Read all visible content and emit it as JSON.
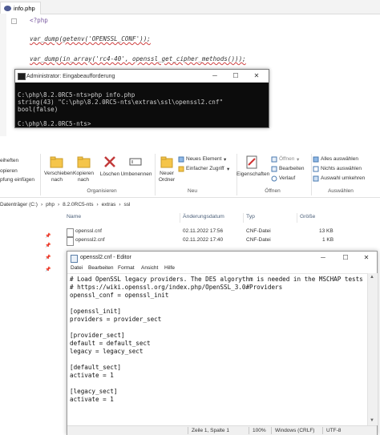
{
  "editor": {
    "tab_title": "info.php",
    "lines": [
      "<?php",
      "var_dump(getenv('OPENSSL_CONF'));",
      "var_dump(in_array('rc4-40', openssl_get_cipher_methods()));"
    ]
  },
  "console": {
    "title": "Administrator: Eingabeaufforderung",
    "lines": [
      "C:\\php\\8.2.0RC5-nts>php info.php",
      "string(43) \"C:\\php\\8.2.0RC5-nts\\extras\\ssl\\openssl2.cnf\"",
      "bool(false)",
      "",
      "C:\\php\\8.2.0RC5-nts>"
    ],
    "buttons": {
      "minimize": "─",
      "maximize": "☐",
      "close": "✕"
    }
  },
  "ribbon": {
    "left_partial": [
      "eiheften",
      "opieren",
      "pfung einfügen"
    ],
    "organize": {
      "move_to": "Verschieben nach",
      "copy_to": "Kopieren nach",
      "delete": "Löschen",
      "rename": "Umbenennen",
      "group": "Organisieren"
    },
    "new": {
      "new_folder": "Neuer Ordner",
      "new_item": "Neues Element",
      "easy_access": "Einfacher Zugriff",
      "group": "Neu"
    },
    "open": {
      "properties": "Eigenschaften",
      "open": "Öffnen",
      "edit": "Bearbeiten",
      "history": "Verlauf",
      "group": "Öffnen"
    },
    "select": {
      "select_all": "Alles auswählen",
      "select_none": "Nichts auswählen",
      "invert": "Auswahl umkehren",
      "group": "Auswählen"
    }
  },
  "address": {
    "crumbs": [
      "Datenträger (C:)",
      "php",
      "8.2.0RC5-nts",
      "extras",
      "ssl"
    ]
  },
  "filelist": {
    "headers": {
      "name": "Name",
      "date": "Änderungsdatum",
      "type": "Typ",
      "size": "Größe"
    },
    "rows": [
      {
        "name": "openssl.cnf",
        "date": "02.11.2022 17:56",
        "type": "CNF-Datei",
        "size": "13 KB"
      },
      {
        "name": "openssl2.cnf",
        "date": "02.11.2022 17:40",
        "type": "CNF-Datei",
        "size": "1 KB"
      }
    ]
  },
  "notepad": {
    "title": "openssl2.cnf - Editor",
    "menu": [
      "Datei",
      "Bearbeiten",
      "Format",
      "Ansicht",
      "Hilfe"
    ],
    "lines": [
      "# Load OpenSSL legacy providers. The DES algorythm is needed in the MSCHAP tests",
      "# https://wiki.openssl.org/index.php/OpenSSL_3.0#Providers",
      "openssl_conf = openssl_init",
      "",
      "[openssl_init]",
      "providers = provider_sect",
      "",
      "[provider_sect]",
      "default = default_sect",
      "legacy = legacy_sect",
      "",
      "[default_sect]",
      "activate = 1",
      "",
      "[legacy_sect]",
      "activate = 1"
    ],
    "status": {
      "position": "Zeile 1, Spalte 1",
      "zoom": "100%",
      "line_endings": "Windows (CRLF)",
      "encoding": "UTF-8"
    },
    "buttons": {
      "minimize": "─",
      "maximize": "☐",
      "close": "✕"
    }
  }
}
